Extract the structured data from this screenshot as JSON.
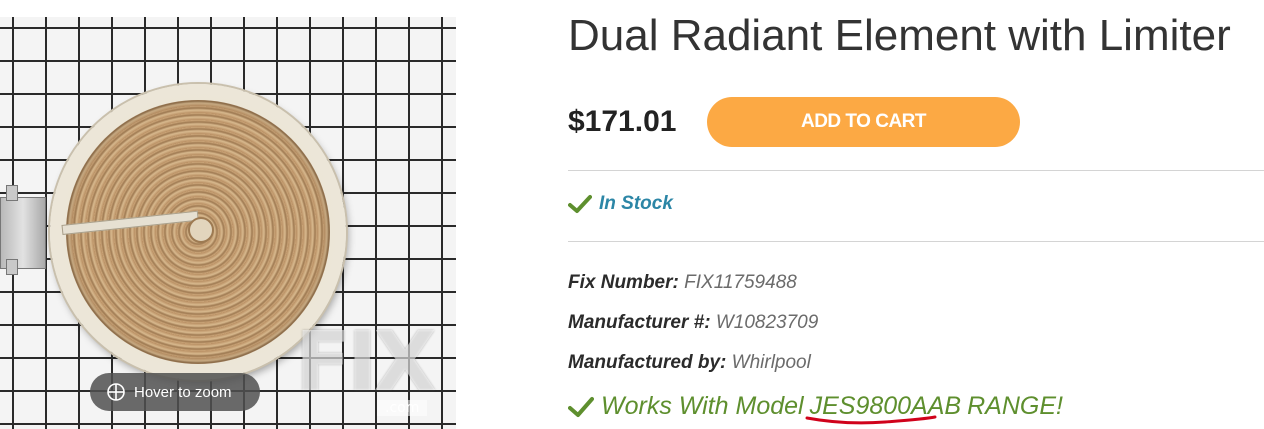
{
  "product": {
    "title": "Dual Radiant Element with Limiter",
    "price": "$171.01",
    "add_to_cart_label": "ADD TO CART",
    "stock_status": "In Stock",
    "specs": [
      {
        "label": "Fix Number:",
        "value": "FIX11759488"
      },
      {
        "label": "Manufacturer #:",
        "value": "W10823709"
      },
      {
        "label": "Manufactured by:",
        "value": "Whirlpool"
      }
    ],
    "works_with": {
      "prefix": "Works With Model",
      "model": "JES9800AAB",
      "suffix": "RANGE!"
    }
  },
  "image": {
    "zoom_hint": "Hover to zoom",
    "watermark": "FIX",
    "watermark_sub": ".com"
  },
  "colors": {
    "accent": "#fca944",
    "stock": "#2c86a6",
    "works": "#5e8f2e",
    "underline": "#d0021b"
  },
  "icons": {
    "stock": "checkmark-icon",
    "works": "checkmark-icon",
    "zoom": "zoom-crosshair-icon"
  }
}
